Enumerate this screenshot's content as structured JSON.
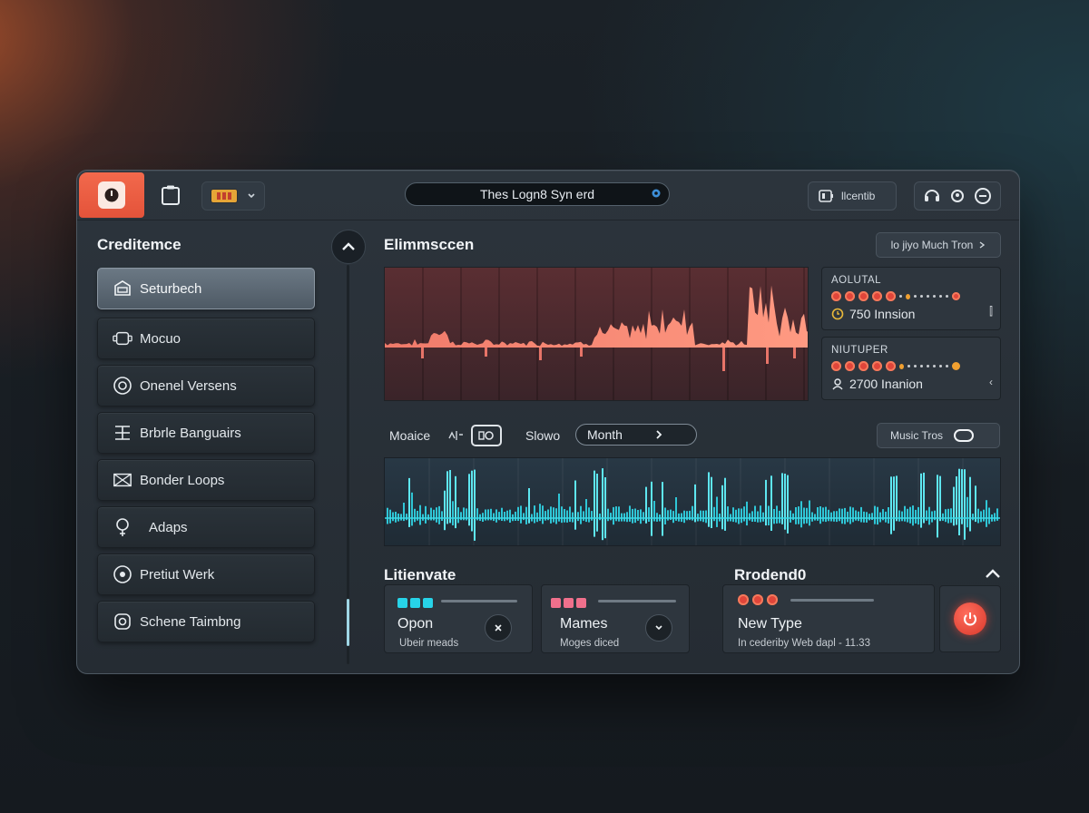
{
  "header": {
    "title": "Thes Logn8 Syn erd",
    "btnA_label": "llcentib",
    "icons": [
      "power-app-icon",
      "clipboard-icon",
      "battery-icon",
      "pin-icon",
      "headset-icon",
      "face-icon",
      "refresh-icon"
    ]
  },
  "sidebar": {
    "title": "Creditemce",
    "items": [
      {
        "label": "Seturbech",
        "icon": "window-icon",
        "active": true
      },
      {
        "label": "Mocuo",
        "icon": "robot-icon",
        "active": false
      },
      {
        "label": "Onenel Versens",
        "icon": "gear-icon",
        "active": false
      },
      {
        "label": "Brbrle Banguairs",
        "icon": "hierarchy-icon",
        "active": false
      },
      {
        "label": "Bonder Loops",
        "icon": "envelope-icon",
        "active": false
      },
      {
        "label": "Adaps",
        "icon": "flower-icon",
        "active": false
      },
      {
        "label": "Pretiut Werk",
        "icon": "dial-icon",
        "active": false
      },
      {
        "label": "Schene Taimbng",
        "icon": "circle-icon",
        "active": false
      }
    ]
  },
  "main": {
    "top_title": "Elimmsccen",
    "top_right_button": "lo jiyo Much Tron",
    "cards": [
      {
        "label": "AOLUTAL",
        "value": "750 Innsion",
        "tail": "⫿"
      },
      {
        "label": "NIUTUPER",
        "value": "2700 Inanion",
        "tail": "‹"
      }
    ],
    "controls": {
      "label1": "Moaice",
      "label2": "Slowo",
      "month": "Month",
      "music_btn": "Music Tros"
    },
    "bottom_left_title": "Litienvate",
    "bottom_right_title": "Rrodend0",
    "panels": [
      {
        "title": "Opon",
        "sub": "Ubeir meads",
        "squares": "cyan"
      },
      {
        "title": "Mames",
        "sub": "Moges diced",
        "squares": "pink"
      },
      {
        "title": "New Type",
        "sub": "In cederiby Web dapl - 11.33",
        "squares": "red"
      }
    ]
  },
  "colors": {
    "accent_orange": "#f2694c",
    "chart_red": "#f08270",
    "chart_cyan": "#2ed3e0",
    "cyan_square": "#27d3e8",
    "pink_square": "#f0708c",
    "red_dot": "#e0453a"
  }
}
